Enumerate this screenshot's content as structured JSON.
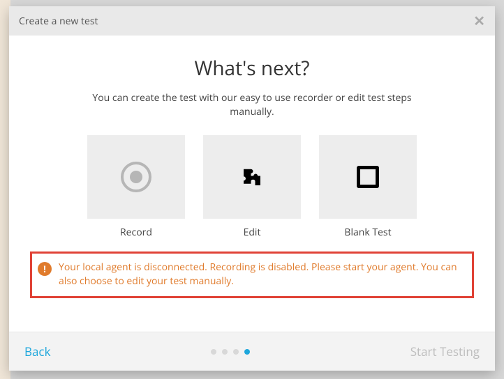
{
  "dialog": {
    "header_title": "Create a new test",
    "heading": "What's next?",
    "subtitle": "You can create the test with our easy to use recorder or edit test steps manually."
  },
  "options": {
    "record": "Record",
    "edit": "Edit",
    "blank": "Blank Test"
  },
  "warning": {
    "badge": "!",
    "text": "Your local agent is disconnected. Recording is disabled. Please start your agent. You can also choose to edit your test manually."
  },
  "footer": {
    "back": "Back",
    "start": "Start Testing",
    "total_steps": 4,
    "active_step_index": 3
  }
}
